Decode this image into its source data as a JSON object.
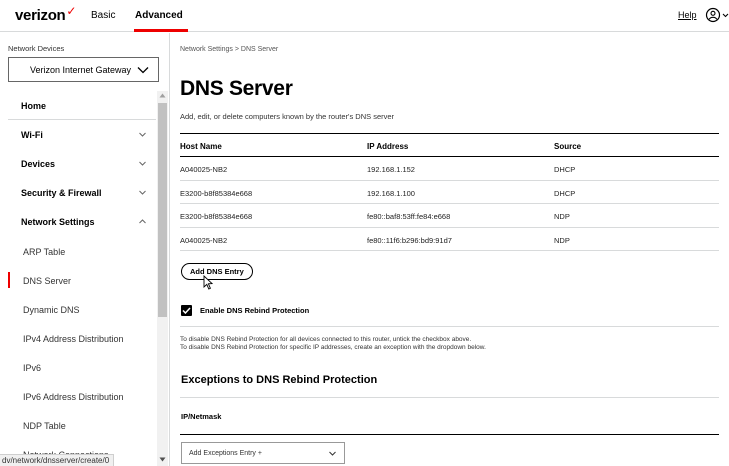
{
  "header": {
    "logo_text": "verizon",
    "logo_check": "✓",
    "tabs": [
      {
        "label": "Basic",
        "active": false
      },
      {
        "label": "Advanced",
        "active": true
      }
    ],
    "help_label": "Help",
    "accent_color": "#ee0000"
  },
  "sidebar": {
    "devices_label": "Network Devices",
    "device_selected": "Verizon Internet Gateway",
    "items": [
      {
        "label": "Home",
        "type": "top",
        "chevron": "none"
      },
      {
        "label": "Wi-Fi",
        "type": "top",
        "chevron": "down"
      },
      {
        "label": "Devices",
        "type": "top",
        "chevron": "down"
      },
      {
        "label": "Security & Firewall",
        "type": "top",
        "chevron": "down"
      },
      {
        "label": "Network Settings",
        "type": "top",
        "chevron": "up"
      },
      {
        "label": "ARP Table",
        "type": "sub"
      },
      {
        "label": "DNS Server",
        "type": "sub",
        "active": true
      },
      {
        "label": "Dynamic DNS",
        "type": "sub"
      },
      {
        "label": "IPv4 Address Distribution",
        "type": "sub"
      },
      {
        "label": "IPv6",
        "type": "sub"
      },
      {
        "label": "IPv6 Address Distribution",
        "type": "sub"
      },
      {
        "label": "NDP Table",
        "type": "sub"
      },
      {
        "label": "Network Connections",
        "type": "sub"
      }
    ]
  },
  "status_url": "dv/network/dnsserver/create/0",
  "main": {
    "breadcrumb": "Network Settings  >  DNS Server",
    "title": "DNS Server",
    "description": "Add, edit, or delete computers known by the router's DNS server",
    "table": {
      "headers": [
        "Host Name",
        "IP Address",
        "Source"
      ],
      "rows": [
        [
          "A040025-NB2",
          "192.168.1.152",
          "DHCP"
        ],
        [
          "E3200-b8f85384e668",
          "192.168.1.100",
          "DHCP"
        ],
        [
          "E3200-b8f85384e668",
          "fe80::baf8:53ff:fe84:e668",
          "NDP"
        ],
        [
          "A040025-NB2",
          "fe80::11f6:b296:bd9:91d7",
          "NDP"
        ]
      ]
    },
    "add_button": "Add DNS Entry",
    "rebind_checkbox": {
      "label": "Enable DNS Rebind Protection",
      "checked": true
    },
    "info_line1": "To disable DNS Rebind Protection for all devices connected to this router, untick the checkbox above.",
    "info_line2": "To disable DNS Rebind Protection for specific IP addresses, create an exception with the dropdown below.",
    "exceptions_title": "Exceptions to DNS Rebind Protection",
    "ip_netmask_label": "IP/Netmask",
    "exceptions_select": "Add Exceptions Entry +"
  }
}
